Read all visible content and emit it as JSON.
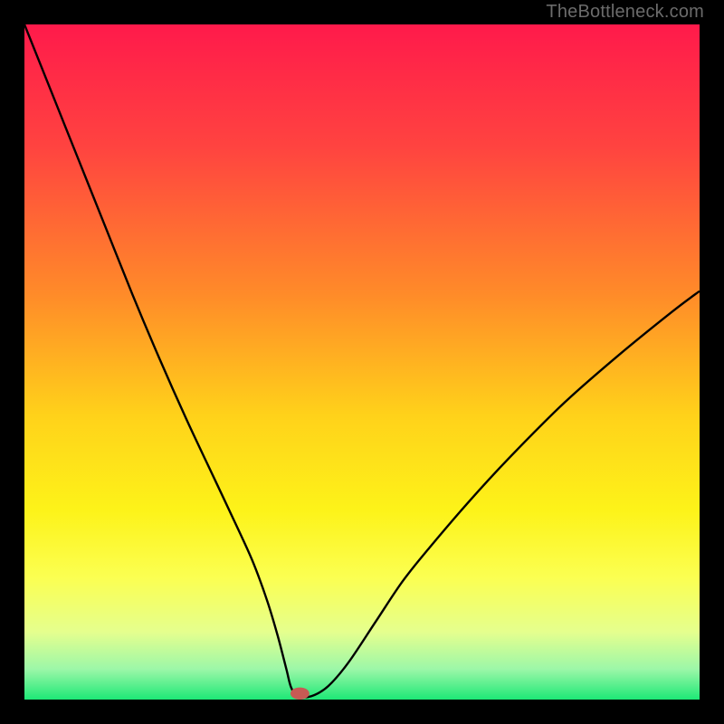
{
  "watermark": "TheBottleneck.com",
  "chart_data": {
    "type": "line",
    "title": "",
    "xlabel": "",
    "ylabel": "",
    "xlim": [
      0,
      100
    ],
    "ylim": [
      0,
      100
    ],
    "grid": false,
    "legend": false,
    "background_gradient": {
      "stops": [
        {
          "offset": 0.0,
          "color": "#ff1a4b"
        },
        {
          "offset": 0.18,
          "color": "#ff4340"
        },
        {
          "offset": 0.4,
          "color": "#ff8b29"
        },
        {
          "offset": 0.58,
          "color": "#ffd21a"
        },
        {
          "offset": 0.72,
          "color": "#fdf319"
        },
        {
          "offset": 0.82,
          "color": "#fbff52"
        },
        {
          "offset": 0.9,
          "color": "#e5ff8e"
        },
        {
          "offset": 0.955,
          "color": "#9cf7a8"
        },
        {
          "offset": 1.0,
          "color": "#1de876"
        }
      ]
    },
    "series": [
      {
        "name": "curve",
        "x": [
          0.0,
          4.0,
          8.0,
          12.0,
          16.0,
          20.0,
          24.0,
          28.0,
          32.0,
          34.0,
          36.0,
          37.5,
          38.8,
          39.5,
          40.5,
          42.5,
          45.0,
          48.0,
          52.0,
          56.0,
          60.0,
          66.0,
          72.0,
          80.0,
          88.0,
          96.0,
          100.0
        ],
        "y": [
          100.0,
          90.0,
          80.0,
          70.0,
          60.0,
          50.5,
          41.5,
          33.0,
          24.5,
          20.0,
          14.5,
          9.5,
          4.5,
          1.8,
          0.5,
          0.5,
          2.0,
          5.5,
          11.5,
          17.5,
          22.5,
          29.5,
          36.0,
          44.0,
          51.0,
          57.5,
          60.5
        ]
      }
    ],
    "marker": {
      "name": "min-point",
      "x": 40.8,
      "y": 0.9,
      "rx": 1.4,
      "ry": 0.9,
      "color": "#c75a54"
    }
  }
}
